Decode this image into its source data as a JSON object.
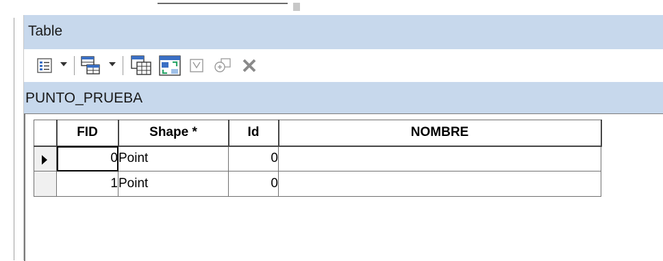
{
  "window": {
    "title": "Table"
  },
  "toolbar": {
    "icons": [
      "table-options-icon",
      "related-tables-icon",
      "select-by-attributes-icon",
      "switch-selection-icon",
      "clear-selection-icon",
      "zoom-to-selected-icon",
      "delete-selected-icon"
    ]
  },
  "layer": {
    "name": "PUNTO_PRUEBA"
  },
  "table": {
    "columns": [
      "FID",
      "Shape *",
      "Id",
      "NOMBRE"
    ],
    "rows": [
      {
        "fid": "0",
        "shape": "Point",
        "id": "0",
        "nombre": ""
      },
      {
        "fid": "1",
        "shape": "Point",
        "id": "0",
        "nombre": ""
      }
    ]
  },
  "colors": {
    "header_band": "#c7d8ec",
    "accent_blue": "#3a6fc4",
    "delete_gray": "#8a8a8a"
  }
}
